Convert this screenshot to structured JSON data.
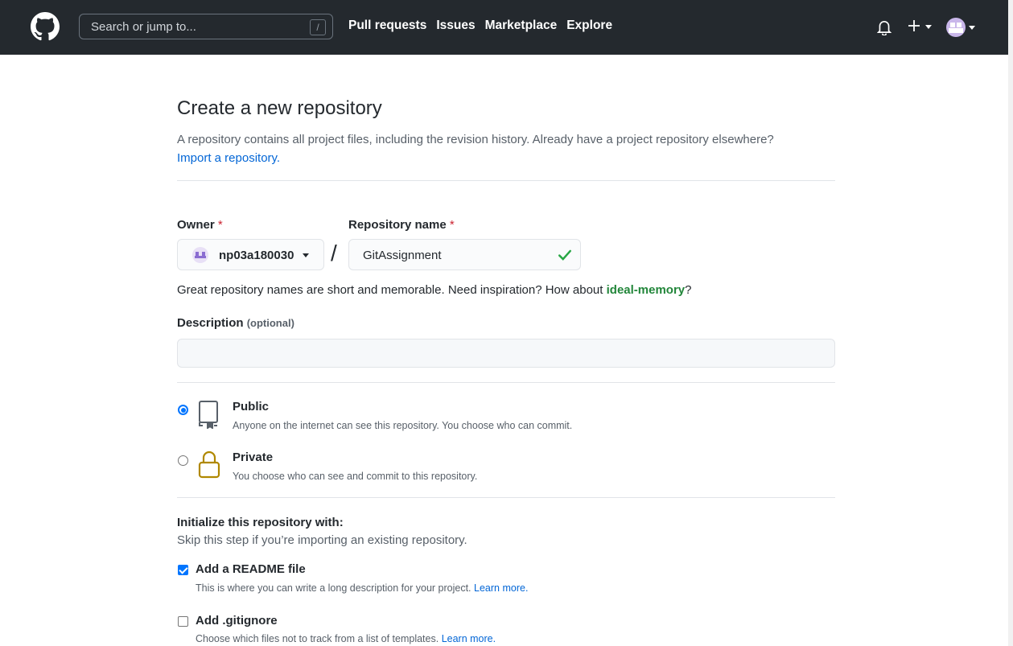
{
  "header": {
    "search_placeholder": "Search or jump to...",
    "search_shortcut": "/",
    "nav": [
      "Pull requests",
      "Issues",
      "Marketplace",
      "Explore"
    ]
  },
  "page": {
    "title": "Create a new repository",
    "subtitle": "A repository contains all project files, including the revision history. Already have a project repository elsewhere?",
    "import_link": "Import a repository."
  },
  "form": {
    "owner_label": "Owner",
    "required_mark": "*",
    "owner_value": "np03a180030",
    "repo_label": "Repository name",
    "repo_value": "GitAssignment",
    "separator": "/",
    "hint_prefix": "Great repository names are short and memorable. Need inspiration? How about ",
    "hint_suggestion": "ideal-memory",
    "hint_suffix": "?",
    "description_label": "Description",
    "description_optional": "(optional)",
    "description_value": ""
  },
  "visibility": {
    "public": {
      "title": "Public",
      "desc": "Anyone on the internet can see this repository. You choose who can commit.",
      "selected": true
    },
    "private": {
      "title": "Private",
      "desc": "You choose who can see and commit to this repository.",
      "selected": false
    }
  },
  "init": {
    "title": "Initialize this repository with:",
    "subtitle": "Skip this step if you’re importing an existing repository.",
    "readme": {
      "label": "Add a README file",
      "desc": "This is where you can write a long description for your project.",
      "link": "Learn more.",
      "checked": true
    },
    "gitignore": {
      "label": "Add .gitignore",
      "desc": "Choose which files not to track from a list of templates.",
      "link": "Learn more.",
      "checked": false
    }
  },
  "colors": {
    "header_bg": "#24292e",
    "link": "#0366d6",
    "success": "#22863a",
    "required": "#cb2431",
    "accent": "#0075ff",
    "private_lock": "#b08800"
  }
}
